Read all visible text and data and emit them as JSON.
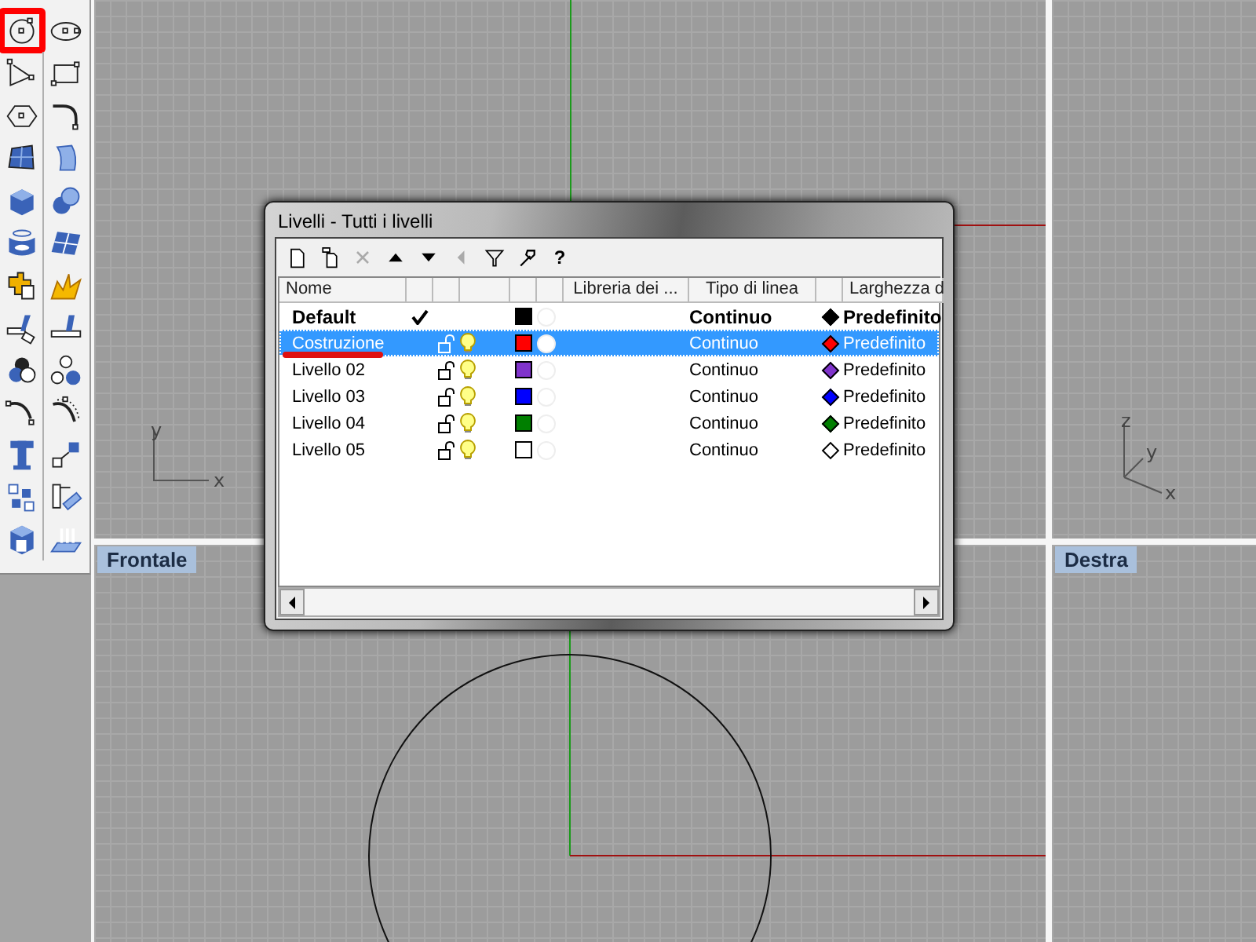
{
  "viewports": [
    {
      "kind": "top",
      "axis_labels": [
        "y",
        "x"
      ]
    },
    {
      "kind": "perspective",
      "axis_labels": [
        "z",
        "y",
        "x"
      ]
    },
    {
      "kind": "front",
      "label": "Frontale"
    },
    {
      "kind": "side",
      "label": "Destra"
    }
  ],
  "dialog": {
    "title": "Livelli - Tutti i livelli",
    "toolbar": [
      {
        "kind": "new",
        "disabled": false
      },
      {
        "kind": "copy",
        "disabled": false
      },
      {
        "kind": "delete",
        "disabled": true
      },
      {
        "kind": "up",
        "disabled": false
      },
      {
        "kind": "down",
        "disabled": false
      },
      {
        "kind": "back",
        "disabled": true
      },
      {
        "kind": "filter",
        "disabled": false
      },
      {
        "kind": "tools",
        "disabled": false
      },
      {
        "kind": "help",
        "label": "?",
        "disabled": false
      }
    ],
    "columns": [
      {
        "kind": "text",
        "label": "Nome"
      },
      {
        "kind": "blank"
      },
      {
        "kind": "blank"
      },
      {
        "kind": "blank"
      },
      {
        "kind": "blank"
      },
      {
        "kind": "blank"
      },
      {
        "kind": "text",
        "label": "Libreria dei ..."
      },
      {
        "kind": "text",
        "label": "Tipo di linea"
      },
      {
        "kind": "blank"
      },
      {
        "kind": "text",
        "label": "Larghezza d"
      }
    ],
    "rows": [
      {
        "name": "Default",
        "selected": false,
        "current": true,
        "color": "#000000",
        "linetype": "Continuo",
        "print": {
          "color": "#000000",
          "width": "Predefinito"
        }
      },
      {
        "name": "Costruzione",
        "selected": true,
        "current": false,
        "color": "#ff0000",
        "linetype": "Continuo",
        "print": {
          "color": "#ff0000",
          "width": "Predefinito"
        }
      },
      {
        "name": "Livello 02",
        "selected": false,
        "current": false,
        "color": "#8033cc",
        "linetype": "Continuo",
        "print": {
          "color": "#8033cc",
          "width": "Predefinito"
        }
      },
      {
        "name": "Livello 03",
        "selected": false,
        "current": false,
        "color": "#0000ff",
        "linetype": "Continuo",
        "print": {
          "color": "#0000ff",
          "width": "Predefinito"
        }
      },
      {
        "name": "Livello 04",
        "selected": false,
        "current": false,
        "color": "#007f00",
        "linetype": "Continuo",
        "print": {
          "color": "#007f00",
          "width": "Predefinito"
        }
      },
      {
        "name": "Livello 05",
        "selected": false,
        "current": false,
        "color": "#ffffff",
        "linetype": "Continuo",
        "print": {
          "color": "#ffffff",
          "width": "Predefinito"
        }
      }
    ]
  }
}
